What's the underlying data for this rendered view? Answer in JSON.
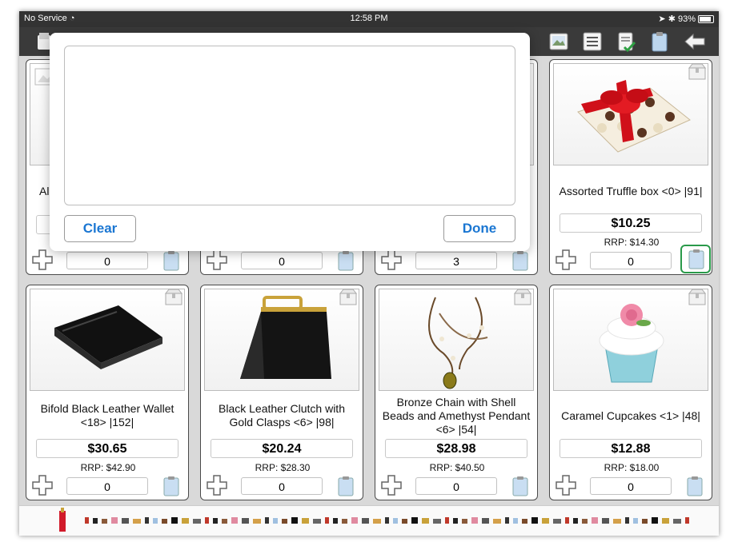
{
  "status_bar": {
    "carrier": "No Service",
    "time": "12:58 PM",
    "battery": "93%"
  },
  "toolbar": {
    "icons": [
      "gallery-icon",
      "list-icon",
      "order-approved-icon",
      "clipboard-icon",
      "back-arrow-icon"
    ]
  },
  "products": [
    {
      "name": "Al",
      "price": "",
      "rrp": "",
      "qty": "0"
    },
    {
      "name": "",
      "price": "",
      "rrp": "",
      "qty": "0"
    },
    {
      "name": "",
      "price": "",
      "rrp": "",
      "qty": "3"
    },
    {
      "name": "Assorted Truffle box <0> |91|",
      "price": "$10.25",
      "rrp": "RRP: $14.30",
      "qty": "0"
    },
    {
      "name": "Bifold Black Leather Wallet <18> |152|",
      "price": "$30.65",
      "rrp": "RRP: $42.90",
      "qty": "0"
    },
    {
      "name": "Black Leather Clutch with Gold Clasps <6> |98|",
      "price": "$20.24",
      "rrp": "RRP: $28.30",
      "qty": "0"
    },
    {
      "name": "Bronze Chain with Shell Beads and Amethyst Pendant <6> |54|",
      "price": "$28.98",
      "rrp": "RRP: $40.50",
      "qty": "0"
    },
    {
      "name": "Caramel Cupcakes <1> |48|",
      "price": "$12.88",
      "rrp": "RRP: $18.00",
      "qty": "0"
    }
  ],
  "popover": {
    "text_value": "",
    "clear_label": "Clear",
    "done_label": "Done"
  },
  "colors": {
    "accent": "#1a76d2",
    "highlight": "#2a9a4a",
    "toolbar_bg": "#3a3a3a"
  }
}
